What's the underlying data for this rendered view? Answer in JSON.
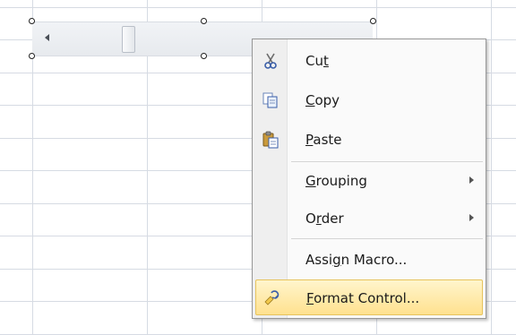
{
  "menu": {
    "items": [
      {
        "id": "cut",
        "pre": "Cu",
        "accel": "t",
        "post": "",
        "icon": "scissors-icon"
      },
      {
        "id": "copy",
        "pre": "",
        "accel": "C",
        "post": "opy",
        "icon": "copy-icon"
      },
      {
        "id": "paste",
        "pre": "",
        "accel": "P",
        "post": "aste",
        "icon": "paste-icon"
      },
      {
        "id": "grouping",
        "pre": "",
        "accel": "G",
        "post": "rouping",
        "submenu": true
      },
      {
        "id": "order",
        "pre": "O",
        "accel": "r",
        "post": "der",
        "submenu": true
      },
      {
        "id": "assign-macro",
        "pre": "Assi",
        "accel": "g",
        "post": "n Macro...",
        "hasIcon": false
      },
      {
        "id": "format-control",
        "pre": "",
        "accel": "F",
        "post": "ormat Control...",
        "icon": "format-control-icon",
        "highlighted": true
      }
    ]
  },
  "colors": {
    "grid": "#d6dbe3",
    "highlight": "#ffe18f",
    "menu_border": "#979797"
  }
}
